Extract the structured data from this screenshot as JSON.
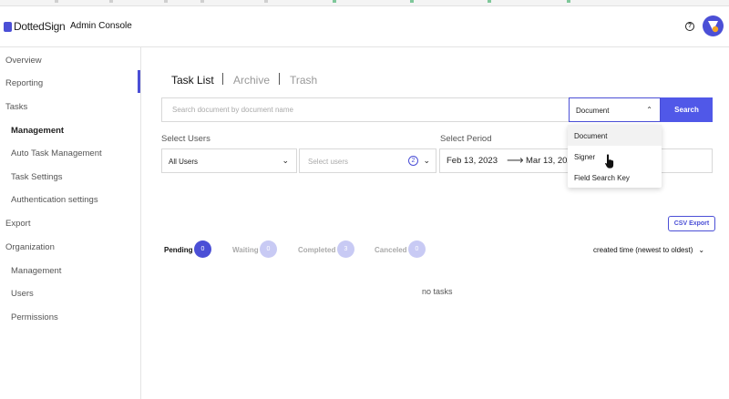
{
  "app": {
    "logo_text": "DottedSign",
    "console_title": "Admin Console",
    "help_icon": "?",
    "colors": {
      "accent": "#4b4fd6",
      "button": "#5058e8",
      "badge_inactive": "#c8caf4",
      "avatar_dot": "#f5a623"
    }
  },
  "sidebar": {
    "items": [
      {
        "label": "Overview"
      },
      {
        "label": "Reporting"
      },
      {
        "label": "Tasks"
      },
      {
        "label": "Management"
      },
      {
        "label": "Auto Task Management"
      },
      {
        "label": "Task Settings"
      },
      {
        "label": "Authentication settings"
      },
      {
        "label": "Export"
      },
      {
        "label": "Organization"
      },
      {
        "label": "Management"
      },
      {
        "label": "Users"
      },
      {
        "label": "Permissions"
      }
    ]
  },
  "tabs": [
    {
      "label": "Task List"
    },
    {
      "label": "Archive"
    },
    {
      "label": "Trash"
    }
  ],
  "search": {
    "placeholder": "Search document by document name",
    "type_selected": "Document",
    "button_label": "Search",
    "dropdown_options": [
      "Document",
      "Signer",
      "Field Search Key"
    ]
  },
  "filters": {
    "users_label": "Select Users",
    "users_value": "All Users",
    "users_multi_placeholder": "Select users",
    "users_multi_count": "2",
    "period_label": "Select Period",
    "period_from": "Feb 13, 2023",
    "period_to": "Mar 13, 2023"
  },
  "csv_export_label": "CSV Export",
  "status_tabs": [
    {
      "label": "Pending",
      "count": "0"
    },
    {
      "label": "Waiting",
      "count": "0"
    },
    {
      "label": "Completed",
      "count": "3"
    },
    {
      "label": "Canceled",
      "count": "0"
    }
  ],
  "sort_label": "created time (newest to oldest)",
  "empty_message": "no tasks"
}
